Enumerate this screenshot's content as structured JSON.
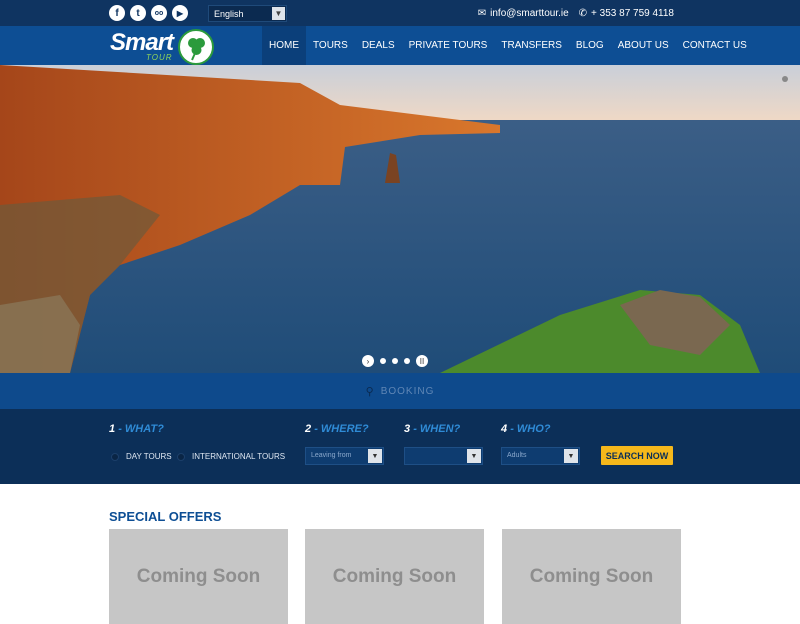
{
  "topbar": {
    "social": [
      "f",
      "t",
      "oo",
      "▶"
    ],
    "language": "English",
    "email": "info@smarttour.ie",
    "phone": "+ 353 87 759 4118"
  },
  "logo": {
    "word": "Smart",
    "sub": "TOUR"
  },
  "nav": [
    "HOME",
    "TOURS",
    "DEALS",
    "PRIVATE TOURS",
    "TRANSFERS",
    "BLOG",
    "ABOUT US",
    "CONTACT US"
  ],
  "booking": {
    "tab_label": "BOOKING",
    "steps": [
      {
        "num": "1",
        "label": "- WHAT?"
      },
      {
        "num": "2",
        "label": "- WHERE?"
      },
      {
        "num": "3",
        "label": "- WHEN?"
      },
      {
        "num": "4",
        "label": "- WHO?"
      }
    ],
    "options": [
      "DAY TOURS",
      "INTERNATIONAL TOURS"
    ],
    "where_placeholder": "Leaving from",
    "when_value": "",
    "who_value": "Adults",
    "search_label": "SEARCH NOW"
  },
  "offers": {
    "title": "SPECIAL OFFERS",
    "cards": [
      "Coming Soon",
      "Coming Soon",
      "Coming Soon"
    ]
  },
  "colors": {
    "navy": "#0f3461",
    "blue": "#0d4e94",
    "accent": "#f6b81b"
  }
}
